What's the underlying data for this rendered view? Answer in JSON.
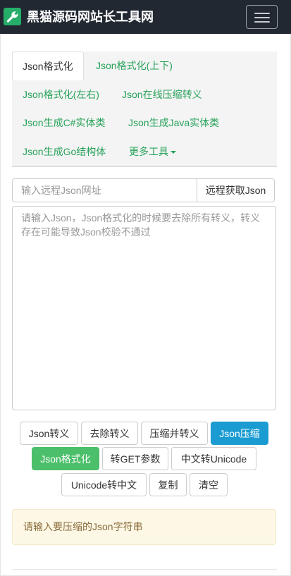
{
  "header": {
    "brand_title": "黑猫源码网站长工具网",
    "brand_icon": "wrench-icon",
    "menu_icon": "hamburger-icon",
    "navbar_color": "#212832",
    "brand_icon_color": "#27ad6a"
  },
  "tabs": [
    {
      "label": "Json格式化",
      "active": true
    },
    {
      "label": "Json格式化(上下)",
      "active": false
    },
    {
      "label": "Json格式化(左右)",
      "active": false
    },
    {
      "label": "Json在线压缩转义",
      "active": false
    },
    {
      "label": "Json生成C#实体类",
      "active": false
    },
    {
      "label": "Json生成Java实体类",
      "active": false
    },
    {
      "label": "Json生成Go结构体",
      "active": false
    },
    {
      "label": "更多工具",
      "active": false,
      "dropdown": true
    }
  ],
  "remote": {
    "placeholder": "输入远程Json网址",
    "value": "",
    "button_label": "远程获取Json"
  },
  "editor": {
    "placeholder": "请输入Json，Json格式化的时候要去除所有转义，转义存在可能导致Json校验不通过",
    "value": ""
  },
  "actions": [
    {
      "label": "Json转义",
      "style": "default"
    },
    {
      "label": "去除转义",
      "style": "default"
    },
    {
      "label": "压缩并转义",
      "style": "default"
    },
    {
      "label": "Json压缩",
      "style": "info"
    },
    {
      "label": "Json格式化",
      "style": "success"
    },
    {
      "label": "转GET参数",
      "style": "default"
    },
    {
      "label": "中文转Unicode",
      "style": "default"
    },
    {
      "label": "Unicode转中文",
      "style": "default"
    },
    {
      "label": "复制",
      "style": "default"
    },
    {
      "label": "清空",
      "style": "default"
    }
  ],
  "alert": {
    "message": "请输入要压缩的Json字符串",
    "color": "#fdf8e6"
  },
  "colors": {
    "accent_green": "#27a25a",
    "info_blue": "#1a9cd2",
    "success_green": "#4cbf6a"
  }
}
